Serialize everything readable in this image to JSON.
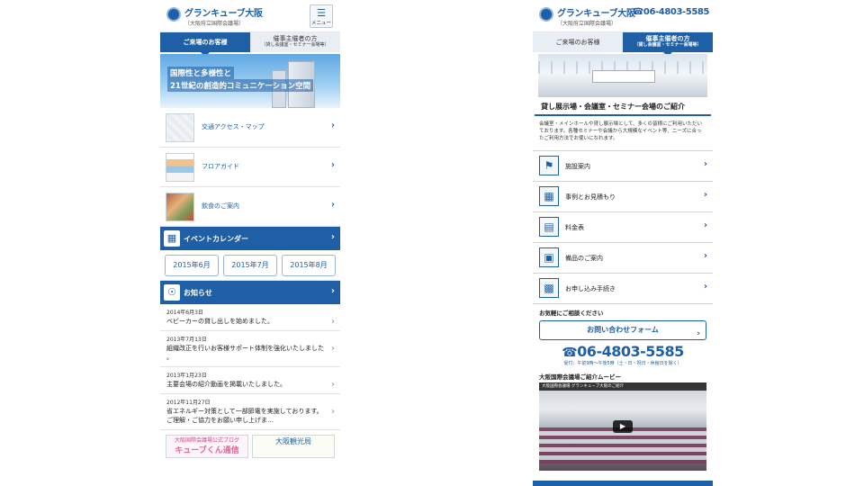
{
  "left": {
    "logo_title": "グランキューブ大阪",
    "logo_sub": "（大阪府立国際会議場）",
    "menu_label": "メニュー",
    "tabs": [
      {
        "label": "ご来場のお客様"
      },
      {
        "label": "催事主催者の方",
        "sub": "（貸し会議室・セミナー会場等）"
      }
    ],
    "hero_lines": [
      "国際性と多様性と",
      "21世紀の創造的コミュニケーション空間"
    ],
    "rows": [
      {
        "label": "交通アクセス・マップ"
      },
      {
        "label": "フロアガイド"
      },
      {
        "label": "飲食のご案内"
      }
    ],
    "event_calendar": "イベントカレンダー",
    "months": [
      "2015年6月",
      "2015年7月",
      "2015年8月"
    ],
    "news_header": "お知らせ",
    "news": [
      {
        "date": "2014年6月3日",
        "title": "ベビーカーの貸し出しを始めました。"
      },
      {
        "date": "2013年7月13日",
        "title": "組織改正を行いお客様サポート体制を強化いたしました 。"
      },
      {
        "date": "2013年1月23日",
        "title": "主要会場の紹介動画を掲載いたしました。"
      },
      {
        "date": "2012年11月27日",
        "title": "省エネルギー対策として一部節電を実施しております。ご理解・ご協力をお願い申し上げま…"
      }
    ],
    "banner1_small": "大阪国際会議場公式ブログ",
    "banner1_big": "キューブくん通信",
    "banner2": "大阪観光局"
  },
  "right": {
    "logo_title": "グランキューブ大阪",
    "logo_sub": "（大阪府立国際会議場）",
    "tel_header": "06-4803-5585",
    "tabs": [
      {
        "label": "ご来場のお客様"
      },
      {
        "label": "催事主催者の方",
        "sub": "（貸し会議室・セミナー会場等）"
      }
    ],
    "section_title": "貸し展示場・会議室・セミナー会場のご紹介",
    "description": "会議室・メインホールや貸し展示場として、多くの皆様にご利用いただいております。各種セミナーや会議から大規模なイベント等、ニーズに合ったご利用方法でお使いになれます。",
    "items": [
      {
        "label": "施設案内",
        "icon": "signpost-icon"
      },
      {
        "label": "事例とお見積もり",
        "icon": "calculator-icon"
      },
      {
        "label": "料金表",
        "icon": "document-icon"
      },
      {
        "label": "備品のご案内",
        "icon": "projector-icon"
      },
      {
        "label": "お申し込み手続き",
        "icon": "grid-icon"
      }
    ],
    "consult": "お気軽にご相談ください",
    "form_button": "お問い合わせフォーム",
    "tel_big": "06-4803-5585",
    "tel_note": "受付：午前9時〜午後5時（土・日・祝日・休館日を除く）",
    "movie_title": "大阪国際会議場ご紹介ムービー",
    "video_caption": "大阪国際会議場 グランキューブ大阪のご紹介"
  },
  "colors": {
    "accent": "#1f5fa6",
    "tab_inactive": "#e9eef4"
  }
}
